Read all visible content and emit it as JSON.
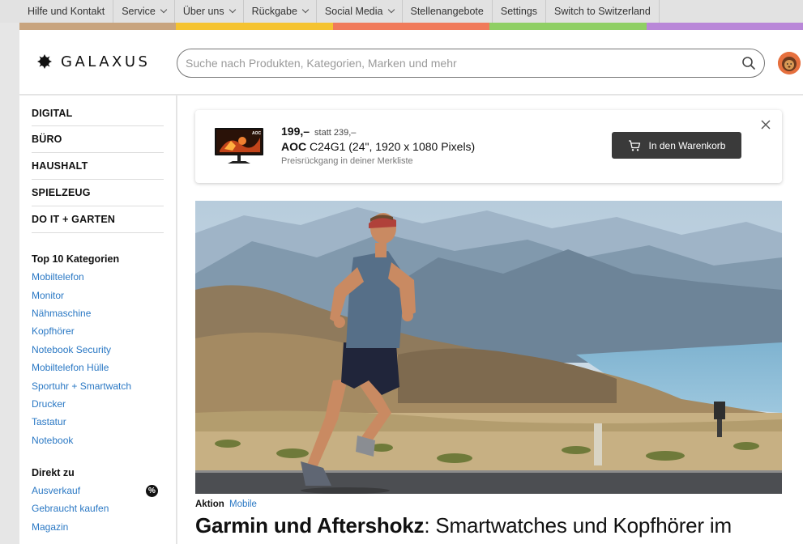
{
  "topnav": {
    "items": [
      {
        "label": "Hilfe und Kontakt",
        "dropdown": false
      },
      {
        "label": "Service",
        "dropdown": true
      },
      {
        "label": "Über uns",
        "dropdown": true
      },
      {
        "label": "Rückgabe",
        "dropdown": true
      },
      {
        "label": "Social Media",
        "dropdown": true
      },
      {
        "label": "Stellenangebote",
        "dropdown": false
      },
      {
        "label": "Settings",
        "dropdown": false
      },
      {
        "label": "Switch to Switzerland",
        "dropdown": false
      }
    ],
    "stripe_colors": [
      "#c8a47e",
      "#f5c330",
      "#f07a5a",
      "#8fcf64",
      "#b987d8"
    ]
  },
  "header": {
    "logo_text": "GALAXUS",
    "search_placeholder": "Suche nach Produkten, Kategorien, Marken und mehr"
  },
  "sidebar": {
    "categories": [
      "DIGITAL",
      "BÜRO",
      "HAUSHALT",
      "SPIELZEUG",
      "DO IT + GARTEN"
    ],
    "top10_heading": "Top 10 Kategorien",
    "top10": [
      "Mobiltelefon",
      "Monitor",
      "Nähmaschine",
      "Kopfhörer",
      "Notebook Security",
      "Mobiltelefon Hülle",
      "Sportuhr + Smartwatch",
      "Drucker",
      "Tastatur",
      "Notebook"
    ],
    "direkt_heading": "Direkt zu",
    "direkt": [
      {
        "label": "Ausverkauf",
        "badge": "%"
      },
      {
        "label": "Gebraucht kaufen"
      },
      {
        "label": "Magazin"
      }
    ]
  },
  "notice": {
    "price": "199,–",
    "old_price": "statt 239,–",
    "product_brand": "AOC",
    "product_name": "C24G1 (24\", 1920 x 1080 Pixels)",
    "subtitle": "Preisrückgang in deiner Merkliste",
    "cart_label": "In den Warenkorb",
    "monitor_brand": "AOC"
  },
  "article": {
    "tag1": "Aktion",
    "tag2": "Mobile",
    "headline_bold": "Garmin und Aftershokz",
    "headline_rest": ": Smartwatches und Kopfhörer im"
  }
}
